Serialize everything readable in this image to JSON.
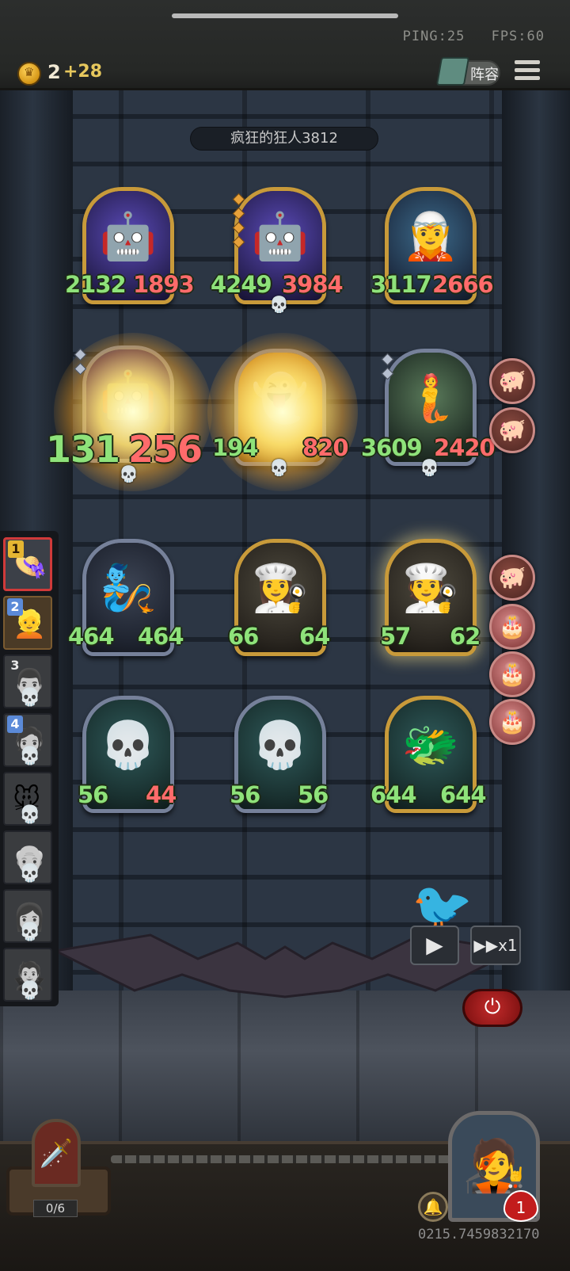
{
  "status": {
    "ping": "PING:25",
    "fps": "FPS:60"
  },
  "currency": {
    "gold": "2",
    "gain": "+28"
  },
  "header": {
    "lineup_label": "阵容"
  },
  "room": {
    "title": "疯狂的狂人3812"
  },
  "board": [
    {
      "id": "r1c1",
      "atk": "2132",
      "hp": "1893",
      "icon": "void-golem"
    },
    {
      "id": "r1c2",
      "atk": "4249",
      "hp": "3984",
      "icon": "void-golem"
    },
    {
      "id": "r1c3",
      "atk": "3117",
      "hp": "2666",
      "icon": "elf-sorceress"
    },
    {
      "id": "r2c1",
      "atk": "131",
      "hp": "256",
      "icon": "void-golem"
    },
    {
      "id": "r2c2",
      "atk": "194",
      "hp": "820",
      "icon": "glowing-spirit"
    },
    {
      "id": "r2c3",
      "atk": "3609",
      "hp": "2420",
      "icon": "singing-mermaid"
    },
    {
      "id": "r3c1",
      "atk": "464",
      "hp": "464",
      "icon": "golden-genie"
    },
    {
      "id": "r3c2",
      "atk": "66",
      "hp": "64",
      "icon": "maid-girl"
    },
    {
      "id": "r3c3",
      "atk": "57",
      "hp": "62",
      "icon": "chef-boy"
    },
    {
      "id": "r4c1",
      "atk": "56",
      "hp": "44",
      "icon": "skeleton-ghost"
    },
    {
      "id": "r4c2",
      "atk": "56",
      "hp": "56",
      "icon": "skeleton-ghost"
    },
    {
      "id": "r4c3",
      "atk": "644",
      "hp": "644",
      "icon": "water-spirit"
    }
  ],
  "queue": [
    {
      "num": "1",
      "style": "gold",
      "face": "👒",
      "dead": false,
      "state": "active"
    },
    {
      "num": "2",
      "style": "blue",
      "face": "👱",
      "dead": false,
      "state": "next"
    },
    {
      "num": "3",
      "style": "dark",
      "face": "👨",
      "dead": true,
      "state": ""
    },
    {
      "num": "4",
      "style": "blue",
      "face": "🧔",
      "dead": true,
      "state": ""
    },
    {
      "num": "",
      "style": "dark",
      "face": "🐭",
      "dead": true,
      "state": ""
    },
    {
      "num": "",
      "style": "dark",
      "face": "👴",
      "dead": true,
      "state": ""
    },
    {
      "num": "",
      "style": "dark",
      "face": "👩",
      "dead": true,
      "state": ""
    },
    {
      "num": "",
      "style": "dark",
      "face": "🧛",
      "dead": true,
      "state": ""
    }
  ],
  "controls": {
    "play_symbol": "▶",
    "speed_label": "▶▶x1",
    "power_symbol": "⏻"
  },
  "shop": {
    "count": "0/6"
  },
  "hero": {
    "lives": "1"
  },
  "version": "0215.7459832170",
  "colors": {
    "atk": "#8ee27a",
    "hp_damaged": "#ff6b6b",
    "gold_frame": "#c89a3a",
    "silver_frame": "#76819a"
  }
}
